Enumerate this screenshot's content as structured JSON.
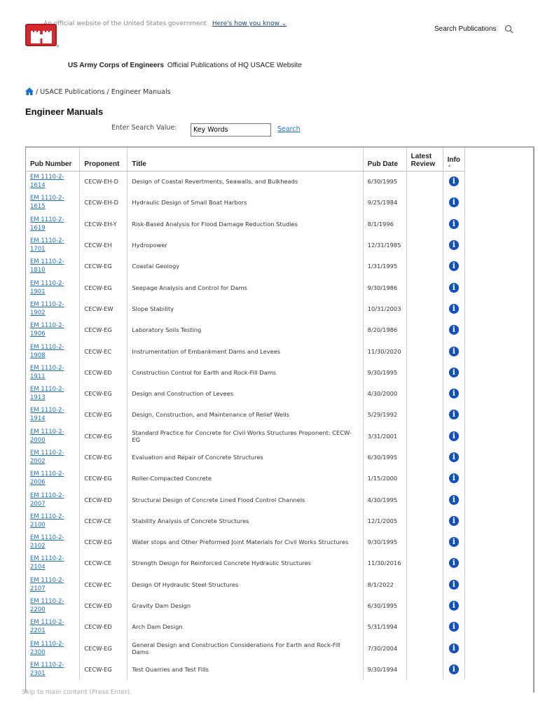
{
  "gov_banner": {
    "text": "An official website of the United States government",
    "link": "Here's how you know"
  },
  "header": {
    "search_label": "Search Publications",
    "brand": "US Army Corps of Engineers",
    "subtitle": "Official Publications of HQ USACE Website"
  },
  "breadcrumb": {
    "sep1": " / ",
    "item1": "USACE Publications",
    "sep2": " / ",
    "item2": "Engineer Manuals"
  },
  "page_title": "Engineer Manuals",
  "search": {
    "label": "Enter Search Value:",
    "value": "Key Words",
    "button": "Search"
  },
  "table": {
    "headers": [
      "Pub Number",
      "Proponent",
      "Title",
      "Pub Date",
      "Latest Review",
      "Info"
    ],
    "rows": [
      {
        "pub": "EM 1110-2-1614",
        "prop": "CECW-EH-D",
        "title": "Design of Coastal Revertments, Seawalls, and Bulkheads",
        "date": "6/30/1995"
      },
      {
        "pub": "EM 1110-2-1615",
        "prop": "CECW-EH-D",
        "title": "Hydraulic Design of Small Boat Harbors",
        "date": "9/25/1984"
      },
      {
        "pub": "EM 1110-2-1619",
        "prop": "CECW-EH-Y",
        "title": "Risk-Based Analysis for Flood Damage Reduction Studies",
        "date": "8/1/1996"
      },
      {
        "pub": "EM 1110-2-1701",
        "prop": "CECW-EH",
        "title": "Hydropower",
        "date": "12/31/1985"
      },
      {
        "pub": "EM 1110-2-1810",
        "prop": "CECW-EG",
        "title": "Coastal Geology",
        "date": "1/31/1995"
      },
      {
        "pub": "EM 1110-2-1901",
        "prop": "CECW-EG",
        "title": "Seepage Analysis and Control for Dams",
        "date": "9/30/1986"
      },
      {
        "pub": "EM 1110-2-1902",
        "prop": "CECW-EW",
        "title": "Slope Stability",
        "date": "10/31/2003"
      },
      {
        "pub": "EM 1110-2-1906",
        "prop": "CECW-EG",
        "title": "Laboratory Soils Testing",
        "date": "8/20/1986"
      },
      {
        "pub": "EM 1110-2-1908",
        "prop": "CECW-EC",
        "title": "Instrumentation of Embankment Dams and Levees",
        "date": "11/30/2020"
      },
      {
        "pub": "EM 1110-2-1911",
        "prop": "CECW-ED",
        "title": "Construction Control for Earth and Rock-Fill Dams",
        "date": "9/30/1995"
      },
      {
        "pub": "EM 1110-2-1913",
        "prop": "CECW-EG",
        "title": "Design and Construction of Levees",
        "date": "4/30/2000"
      },
      {
        "pub": "EM 1110-2-1914",
        "prop": "CECW-EG",
        "title": "Design, Construction, and Maintenance of Relief Wells",
        "date": "5/29/1992"
      },
      {
        "pub": "EM 1110-2-2000",
        "prop": "CECW-EG",
        "title": "Standard Practice for Concrete for Civil Works Structures Proponent: CECW-EG",
        "date": "3/31/2001"
      },
      {
        "pub": "EM 1110-2-2002",
        "prop": "CECW-EG",
        "title": "Evaluation and Repair of Concrete Structures",
        "date": "6/30/1995"
      },
      {
        "pub": "EM 1110-2-2006",
        "prop": "CECW-EG",
        "title": "Roller-Compacted Concrete",
        "date": "1/15/2000"
      },
      {
        "pub": "EM 1110-2-2007",
        "prop": "CECW-ED",
        "title": "Structural Design of Concrete Lined Flood Control Channels",
        "date": "4/30/1995"
      },
      {
        "pub": "EM 1110-2-2100",
        "prop": "CECW-CE",
        "title": "Stability Analysis of Concrete Structures",
        "date": "12/1/2005"
      },
      {
        "pub": "EM 1110-2-2102",
        "prop": "CECW-EG",
        "title": "Water stops and Other Preformed Joint Materials for Civil Works Structures",
        "date": "9/30/1995"
      },
      {
        "pub": "EM 1110-2-2104",
        "prop": "CECW-CE",
        "title": "Strength Design for Reinforced Concrete Hydraulic Structures",
        "date": "11/30/2016"
      },
      {
        "pub": "EM 1110-2-2107",
        "prop": "CECW-EC",
        "title": "Design Of Hydraulic Steel Structures",
        "date": "8/1/2022"
      },
      {
        "pub": "EM 1110-2-2200",
        "prop": "CECW-ED",
        "title": "Gravity Dam Design",
        "date": "6/30/1995"
      },
      {
        "pub": "EM 1110-2-2201",
        "prop": "CECW-ED",
        "title": "Arch Dam Design",
        "date": "5/31/1994"
      },
      {
        "pub": "EM 1110-2-2300",
        "prop": "CECW-EG",
        "title": "General Design and Construction Considerations For Earth and Rock-Fill Dams",
        "date": "7/30/2004"
      },
      {
        "pub": "EM 1110-2-2301",
        "prop": "CECW-EG",
        "title": "Test Quarries and Test Fills",
        "date": "9/30/1994"
      }
    ]
  },
  "skip_link": "Skip to main content (Press Enter)."
}
